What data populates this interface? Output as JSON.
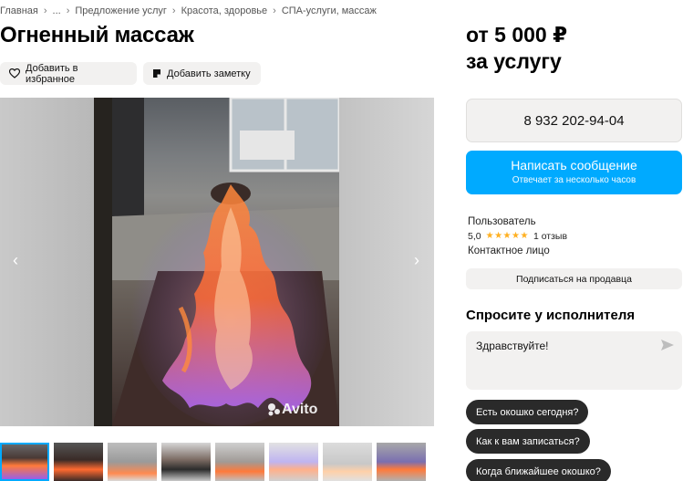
{
  "breadcrumb": [
    "Главная",
    "...",
    "Предложение услуг",
    "Красота, здоровье",
    "СПА-услуги, массаж"
  ],
  "title": "Огненный массаж",
  "actions": {
    "favorite_label": "Добавить в избранное",
    "note_label": "Добавить заметку"
  },
  "gallery": {
    "watermark": "Avito",
    "thumbnail_count": 8,
    "selected_thumbnail": 1
  },
  "price": {
    "line1": "от 5 000 ₽",
    "line2": "за услугу"
  },
  "phone": "8 932 202-94-04",
  "message_button": {
    "label": "Написать сообщение",
    "sublabel": "Отвечает за несколько часов"
  },
  "seller": {
    "name": "Пользователь",
    "rating": "5,0",
    "stars": "★★★★★",
    "reviews": "1 отзыв",
    "role": "Контактное лицо"
  },
  "subscribe_label": "Подписаться на продавца",
  "ask": {
    "title": "Спросите у исполнителя",
    "input_value": "Здравствуйте!",
    "quick_questions": [
      "Есть окошко сегодня?",
      "Как к вам записаться?",
      "Когда ближайшее окошко?"
    ]
  },
  "colors": {
    "accent": "#00aaff",
    "chip": "#2a2a2a",
    "star": "#ffb021",
    "panel": "#f2f1f0"
  },
  "icons": {
    "favorite": "heart-icon",
    "note": "note-icon",
    "prev": "chevron-left-icon",
    "next": "chevron-right-icon",
    "send": "send-icon"
  }
}
